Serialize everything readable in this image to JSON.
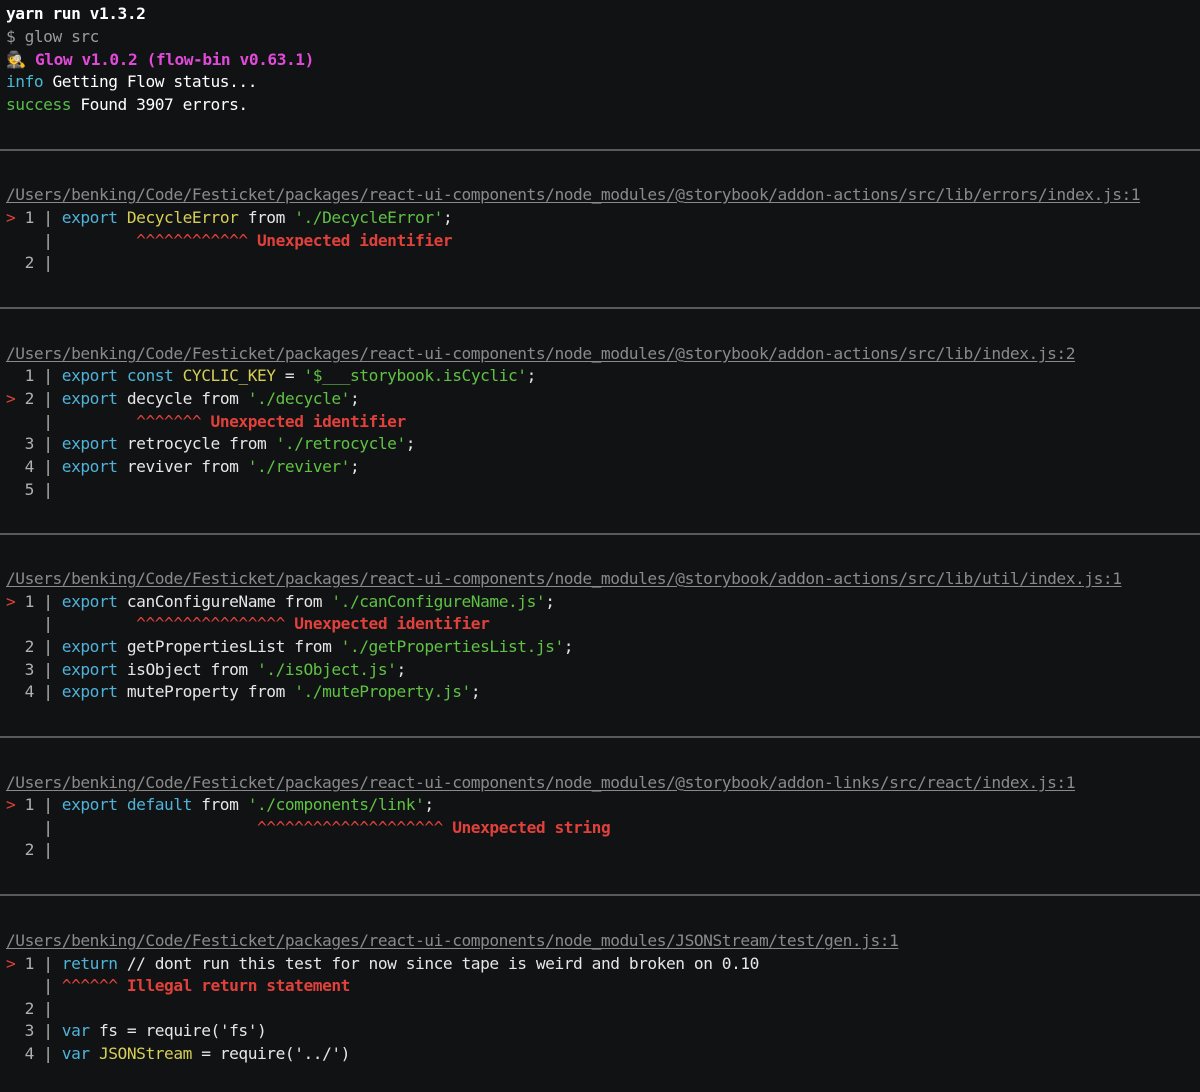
{
  "header": {
    "yarn_line": "yarn run v1.3.2",
    "cmd_line": "$ glow src",
    "glow_icon": "detective-emoji",
    "glow_version": "Glow v1.0.2 (flow-bin v0.63.1)",
    "info_prefix": "info",
    "info_text": "Getting Flow status...",
    "success_prefix": "success",
    "success_text": "Found 3907 errors."
  },
  "errors": [
    {
      "path": "/Users/benking/Code/Festicket/packages/react-ui-components/node_modules/@storybook/addon-actions/src/lib/errors/index.js:1",
      "lines": [
        {
          "marker": ">",
          "num": "1",
          "kw": "export",
          "ident": "DecycleError",
          "mid": "from",
          "str": "'./DecycleError'",
          "tail": ";"
        },
        {
          "caret": "^^^^^^^^^^^^",
          "msg": "Unexpected identifier"
        },
        {
          "num": "2"
        }
      ]
    },
    {
      "path": "/Users/benking/Code/Festicket/packages/react-ui-components/node_modules/@storybook/addon-actions/src/lib/index.js:2",
      "lines": [
        {
          "num": "1",
          "kw": "export const",
          "ident": "CYCLIC_KEY",
          "mid": "=",
          "str": "'$___storybook.isCyclic'",
          "tail": ";"
        },
        {
          "marker": ">",
          "num": "2",
          "kw": "export",
          "ident": "decycle",
          "mid": "from",
          "str": "'./decycle'",
          "tail": ";"
        },
        {
          "caret": "^^^^^^^",
          "msg": "Unexpected identifier"
        },
        {
          "num": "3",
          "kw": "export",
          "ident": "retrocycle",
          "mid": "from",
          "str": "'./retrocycle'",
          "tail": ";"
        },
        {
          "num": "4",
          "kw": "export",
          "ident": "reviver",
          "mid": "from",
          "str": "'./reviver'",
          "tail": ";"
        },
        {
          "num": "5"
        }
      ]
    },
    {
      "path": "/Users/benking/Code/Festicket/packages/react-ui-components/node_modules/@storybook/addon-actions/src/lib/util/index.js:1",
      "lines": [
        {
          "marker": ">",
          "num": "1",
          "kw": "export",
          "ident": "canConfigureName",
          "mid": "from",
          "str": "'./canConfigureName.js'",
          "tail": ";"
        },
        {
          "caret": "^^^^^^^^^^^^^^^^",
          "msg": "Unexpected identifier"
        },
        {
          "num": "2",
          "kw": "export",
          "ident": "getPropertiesList",
          "mid": "from",
          "str": "'./getPropertiesList.js'",
          "tail": ";"
        },
        {
          "num": "3",
          "kw": "export",
          "ident": "isObject",
          "mid": "from",
          "str": "'./isObject.js'",
          "tail": ";"
        },
        {
          "num": "4",
          "kw": "export",
          "ident": "muteProperty",
          "mid": "from",
          "str": "'./muteProperty.js'",
          "tail": ";"
        }
      ]
    },
    {
      "path": "/Users/benking/Code/Festicket/packages/react-ui-components/node_modules/@storybook/addon-links/src/react/index.js:1",
      "lines": [
        {
          "marker": ">",
          "num": "1",
          "kw": "export default",
          "ident": "",
          "mid": "from",
          "str": "'./components/link'",
          "tail": ";"
        },
        {
          "caret": "^^^^^^^^^^^^^^^^^^^^",
          "msg": "Unexpected string"
        },
        {
          "num": "2"
        }
      ]
    },
    {
      "path": "/Users/benking/Code/Festicket/packages/react-ui-components/node_modules/JSONStream/test/gen.js:1",
      "lines": [
        {
          "marker": ">",
          "num": "1",
          "kw": "return",
          "ident": "",
          "mid": "",
          "str": "",
          "tail": "// dont run this test for now since tape is weird and broken on 0.10"
        },
        {
          "caret": "^^^^^^",
          "msg": "Illegal return statement"
        },
        {
          "num": "2"
        },
        {
          "num": "3",
          "kw": "var",
          "ident": "fs",
          "mid": "=",
          "str": "",
          "tail": "require('fs')"
        },
        {
          "num": "4",
          "kw": "var",
          "ident": "JSONStream",
          "mid": "=",
          "str": "",
          "tail": "require('../')"
        }
      ]
    }
  ],
  "colors": {
    "background": "#111214",
    "keyword": "#4fb3d9",
    "string": "#5fc243",
    "error": "#e0413a",
    "glow": "#e14ad9",
    "info": "#49b8d4",
    "success": "#56bf47"
  }
}
